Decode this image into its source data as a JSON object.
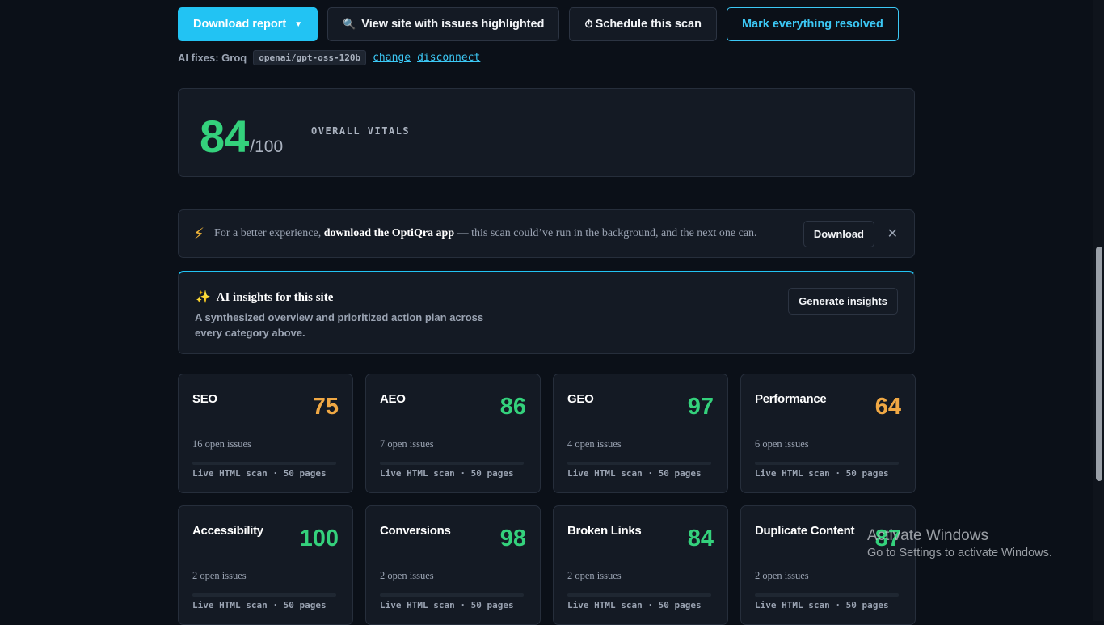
{
  "toolbar": {
    "download_report": "Download report",
    "download_caret": "▼",
    "view_icon": "🔍",
    "view_highlighted": "View site with issues highlighted",
    "schedule_icon": "⏱",
    "schedule_scan": "Schedule this scan",
    "mark_resolved": "Mark everything resolved"
  },
  "ai_fixes": {
    "label": "AI fixes: Groq",
    "model": "openai/gpt-oss-120b",
    "change": "change",
    "disconnect": "disconnect"
  },
  "overall": {
    "score": "84",
    "denominator": "/100",
    "label": "OVERALL VITALS"
  },
  "promo": {
    "icon": "⚡",
    "lead": "For a better experience,",
    "highlight": "download the OptiQra app",
    "rest": "— this scan could’ve run in the background, and the next one can.",
    "download": "Download",
    "close": "✕"
  },
  "insights": {
    "icon": "✨",
    "title": "AI insights for this site",
    "description": "A synthesized overview and prioritized action plan across every category above.",
    "generate": "Generate insights"
  },
  "categories": [
    {
      "name": "SEO",
      "score": "75",
      "issues": "16 open issues",
      "meta": "Live HTML scan · 50 pages"
    },
    {
      "name": "AEO",
      "score": "86",
      "issues": "7 open issues",
      "meta": "Live HTML scan · 50 pages"
    },
    {
      "name": "GEO",
      "score": "97",
      "issues": "4 open issues",
      "meta": "Live HTML scan · 50 pages"
    },
    {
      "name": "Performance",
      "score": "64",
      "issues": "6 open issues",
      "meta": "Live HTML scan · 50 pages"
    },
    {
      "name": "Accessibility",
      "score": "100",
      "issues": "2 open issues",
      "meta": "Live HTML scan · 50 pages"
    },
    {
      "name": "Conversions",
      "score": "98",
      "issues": "2 open issues",
      "meta": "Live HTML scan · 50 pages"
    },
    {
      "name": "Broken Links",
      "score": "84",
      "issues": "2 open issues",
      "meta": "Live HTML scan · 50 pages"
    },
    {
      "name": "Duplicate Content",
      "score": "87",
      "issues": "2 open issues",
      "meta": "Live HTML scan · 50 pages"
    }
  ],
  "colors": {
    "accent": "#22c3f3",
    "good": "#34d17c",
    "warn": "#f0a844"
  },
  "watermark": {
    "line1": "Activate Windows",
    "line2": "Go to Settings to activate Windows."
  }
}
